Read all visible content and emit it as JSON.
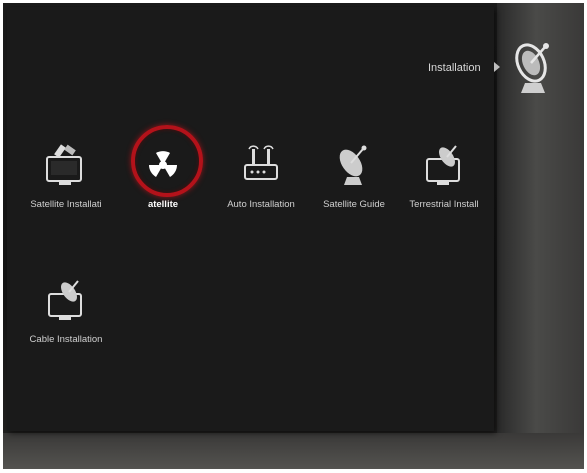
{
  "header": {
    "breadcrumb": "Installation",
    "icon": "satellite-dish-icon"
  },
  "menu": {
    "selected_index": 1,
    "items": [
      {
        "label": "Satellite Installati",
        "icon": "satellite-tv-icon"
      },
      {
        "label": "atellite",
        "icon": "radiation-icon"
      },
      {
        "label": "Auto Installation",
        "icon": "router-antenna-icon"
      },
      {
        "label": "Satellite Guide",
        "icon": "satellite-dish-icon"
      },
      {
        "label": "Terrestrial Install",
        "icon": "tv-antenna-icon"
      },
      {
        "label": "Cable Installation",
        "icon": "tv-antenna-icon"
      }
    ]
  },
  "colors": {
    "focus_ring": "#b3121a",
    "panel": "#1a1a1a"
  }
}
